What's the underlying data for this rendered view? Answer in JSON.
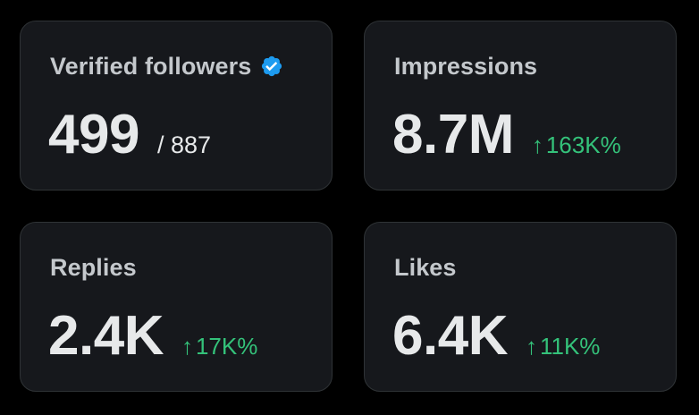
{
  "cards": [
    {
      "title": "Verified followers",
      "value": "499",
      "suffix": "/ 887",
      "icon": "verified-badge-icon",
      "icon_color": "#1d9bf0"
    },
    {
      "title": "Impressions",
      "value": "8.7M",
      "delta": "163K%",
      "delta_icon": "↑",
      "delta_color": "#34c27a"
    },
    {
      "title": "Replies",
      "value": "2.4K",
      "delta": "17K%",
      "delta_icon": "↑",
      "delta_color": "#34c27a"
    },
    {
      "title": "Likes",
      "value": "6.4K",
      "delta": "11K%",
      "delta_icon": "↑",
      "delta_color": "#34c27a"
    }
  ]
}
